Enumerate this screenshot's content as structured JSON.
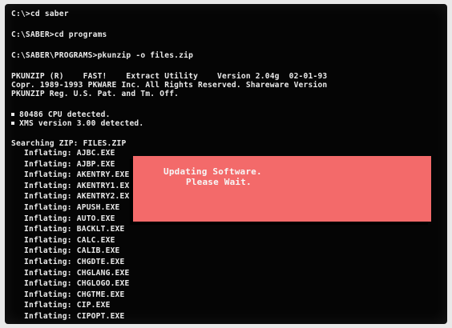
{
  "terminal": {
    "lines": [
      "C:\\>cd saber",
      "C:\\SABER>cd programs",
      "C:\\SABER\\PROGRAMS>pkunzip -o files.zip",
      "PKUNZIP (R)    FAST!    Extract Utility    Version 2.04g  02-01-93",
      "Copr. 1989-1993 PKWARE Inc. All Rights Reserved. Shareware Version",
      "PKUNZIP Reg. U.S. Pat. and Tm. Off.",
      "80486 CPU detected.",
      "XMS version 3.00 detected.",
      "Searching ZIP: FILES.ZIP"
    ],
    "inflating_prefix": "Inflating:",
    "files": [
      "AJBC.EXE",
      "AJBP.EXE",
      "AKENTRY.EXE",
      "AKENTRY1.EXE",
      "AKENTRY2.EXE",
      "APUSH.EXE",
      "AUTO.EXE",
      "BACKLT.EXE",
      "CALC.EXE",
      "CALIB.EXE",
      "CHGDTE.EXE",
      "CHGLANG.EXE",
      "CHGLOGO.EXE",
      "CHGTME.EXE",
      "CIP.EXE",
      "CIPOPT.EXE"
    ]
  },
  "dialog": {
    "line1": "Updating Software.",
    "line2": "Please Wait."
  },
  "colors": {
    "screen_bg": "#050505",
    "text": "#eaeaea",
    "dialog_bg": "#f36a6a"
  }
}
